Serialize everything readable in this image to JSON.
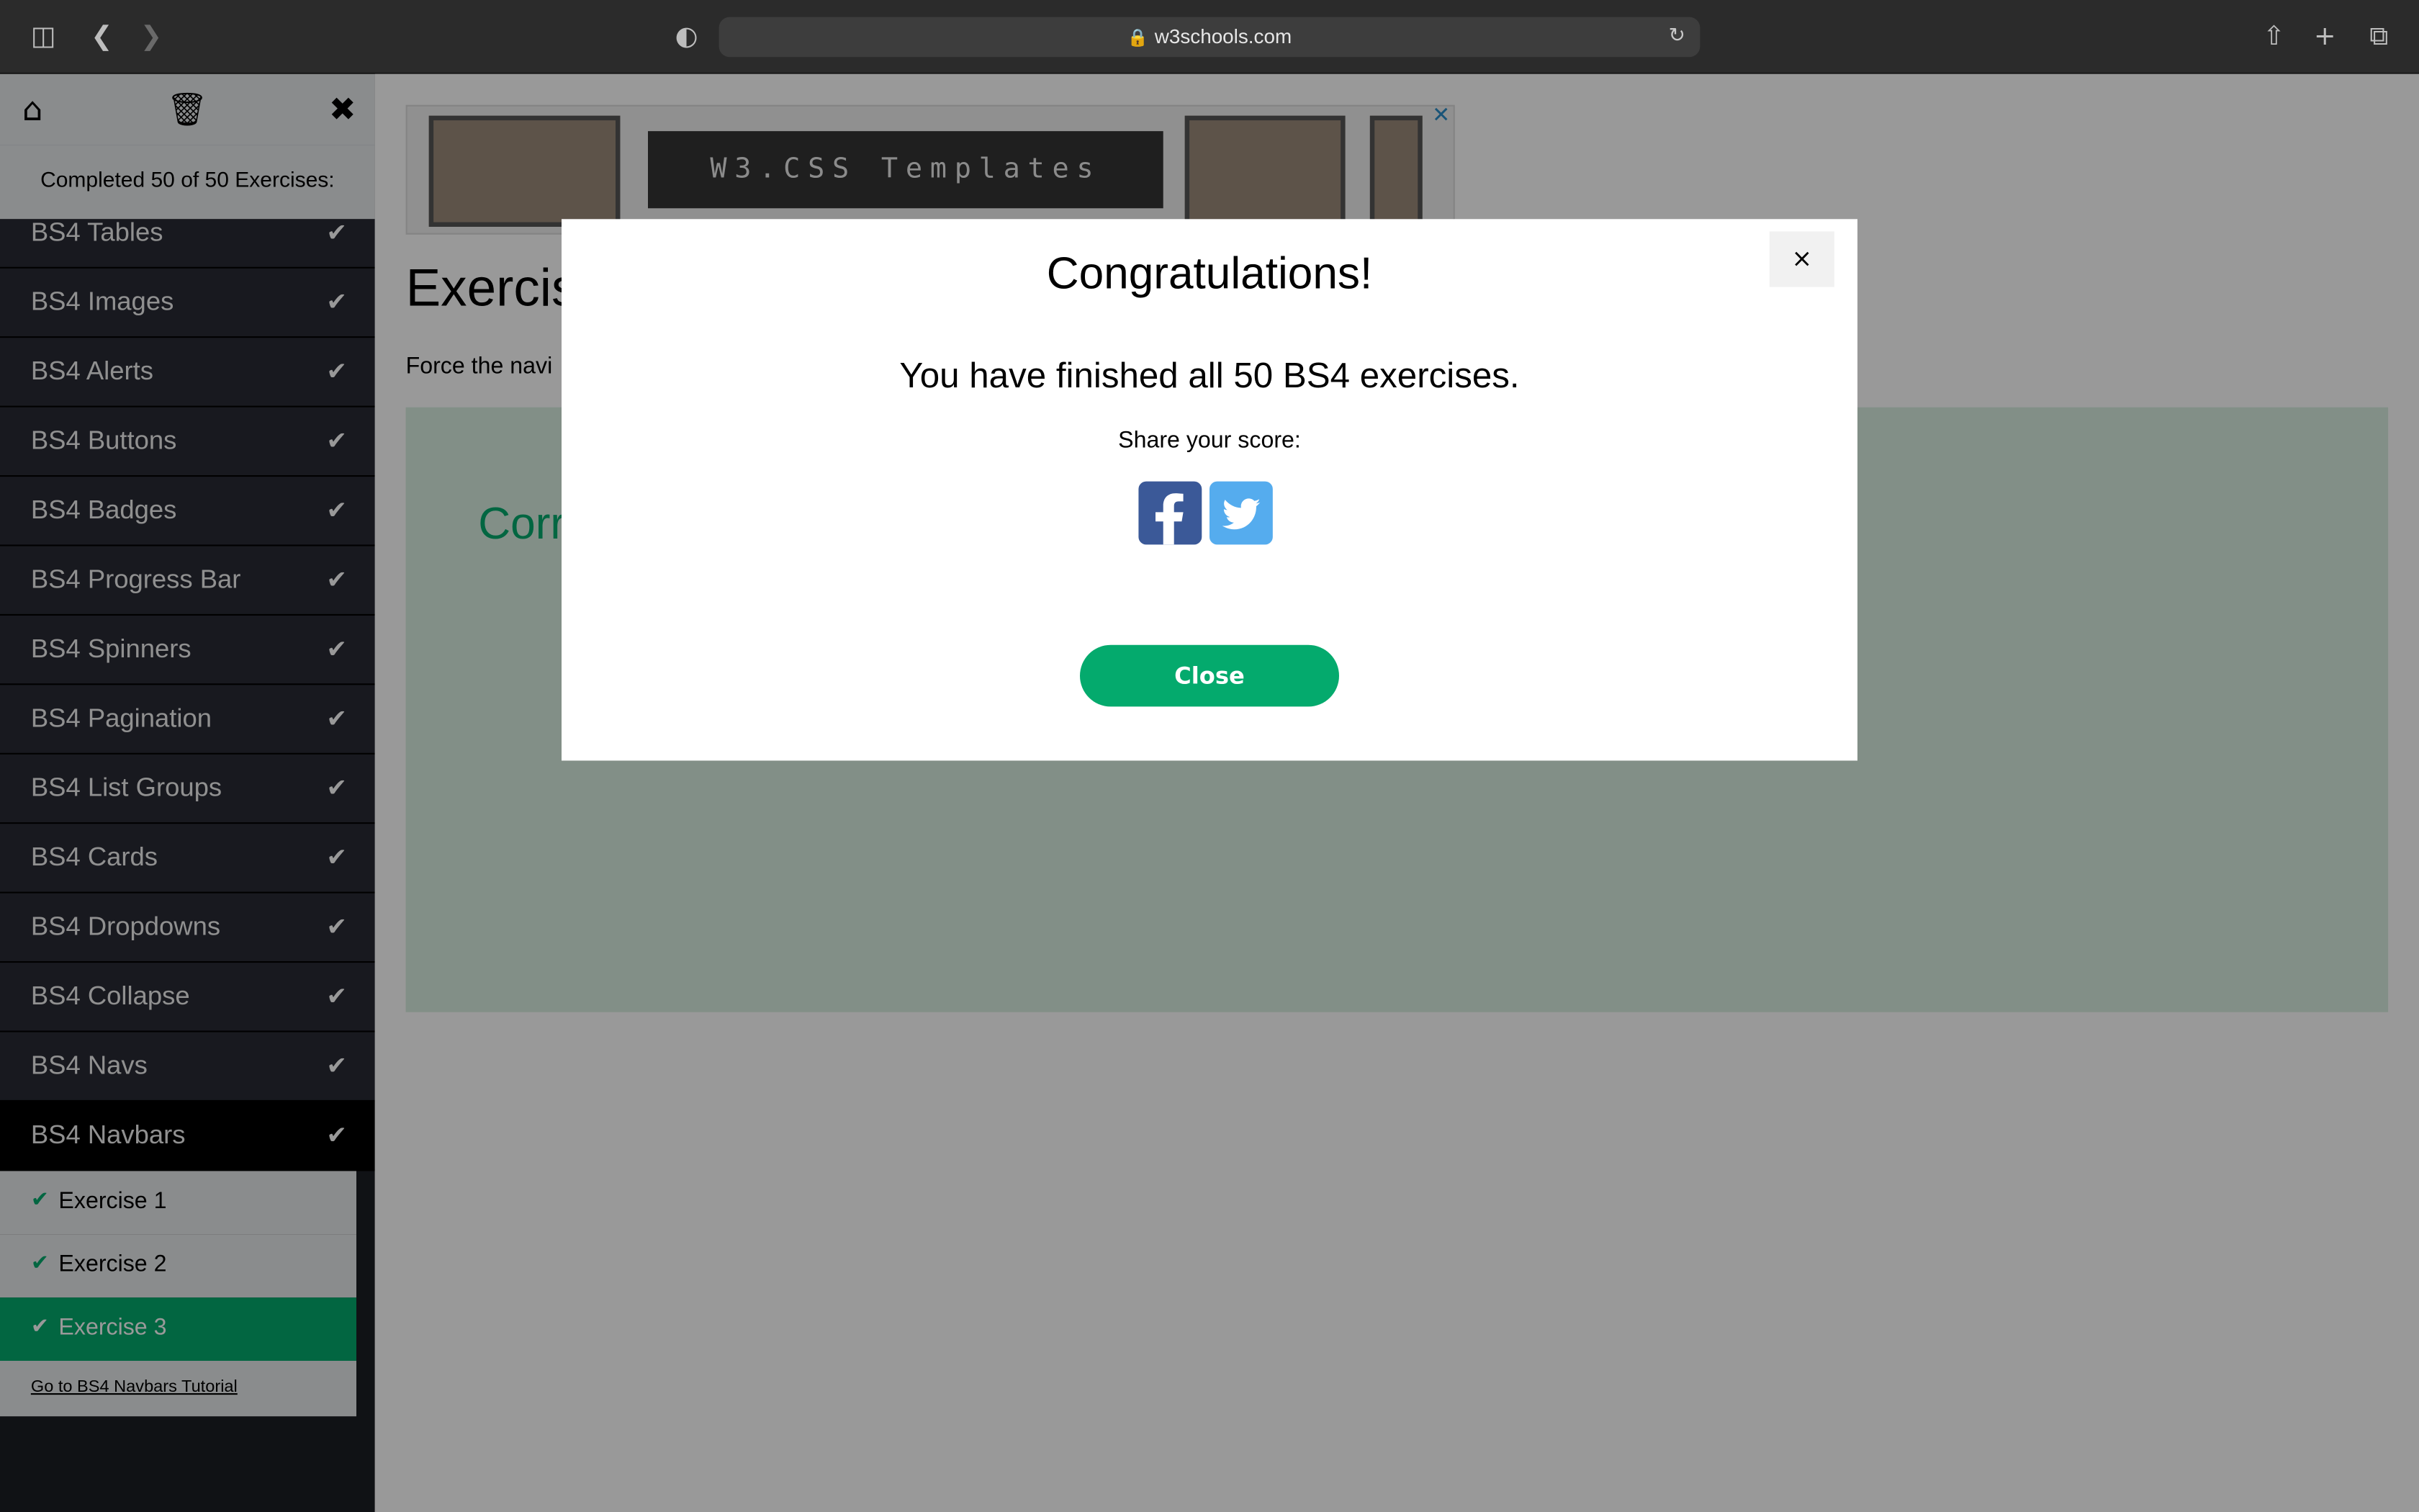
{
  "browser": {
    "url": "w3schools.com"
  },
  "sidebar": {
    "status": "Completed 50 of 50 Exercises:",
    "items": [
      {
        "label": "BS4 Tables"
      },
      {
        "label": "BS4 Images"
      },
      {
        "label": "BS4 Alerts"
      },
      {
        "label": "BS4 Buttons"
      },
      {
        "label": "BS4 Badges"
      },
      {
        "label": "BS4 Progress Bar"
      },
      {
        "label": "BS4 Spinners"
      },
      {
        "label": "BS4 Pagination"
      },
      {
        "label": "BS4 List Groups"
      },
      {
        "label": "BS4 Cards"
      },
      {
        "label": "BS4 Dropdowns"
      },
      {
        "label": "BS4 Collapse"
      },
      {
        "label": "BS4 Navs"
      },
      {
        "label": "BS4 Navbars"
      }
    ],
    "sub_items": [
      {
        "label": "Exercise 1"
      },
      {
        "label": "Exercise 2"
      },
      {
        "label": "Exercise 3"
      }
    ],
    "tutorial_link": "Go to BS4 Navbars Tutorial"
  },
  "main": {
    "ad_banner_text": "W3.CSS Templates",
    "exercise_title": "Exercis",
    "exercise_desc": "Force the navi",
    "result_text": "Corr"
  },
  "modal": {
    "title": "Congratulations!",
    "message": "You have finished all 50 BS4 exercises.",
    "share_label": "Share your score:",
    "close_label": "Close",
    "close_x": "×"
  },
  "colors": {
    "accent": "#04aa6d",
    "sidebar_bg": "#282a35",
    "facebook": "#3b5998",
    "twitter": "#55acee"
  }
}
